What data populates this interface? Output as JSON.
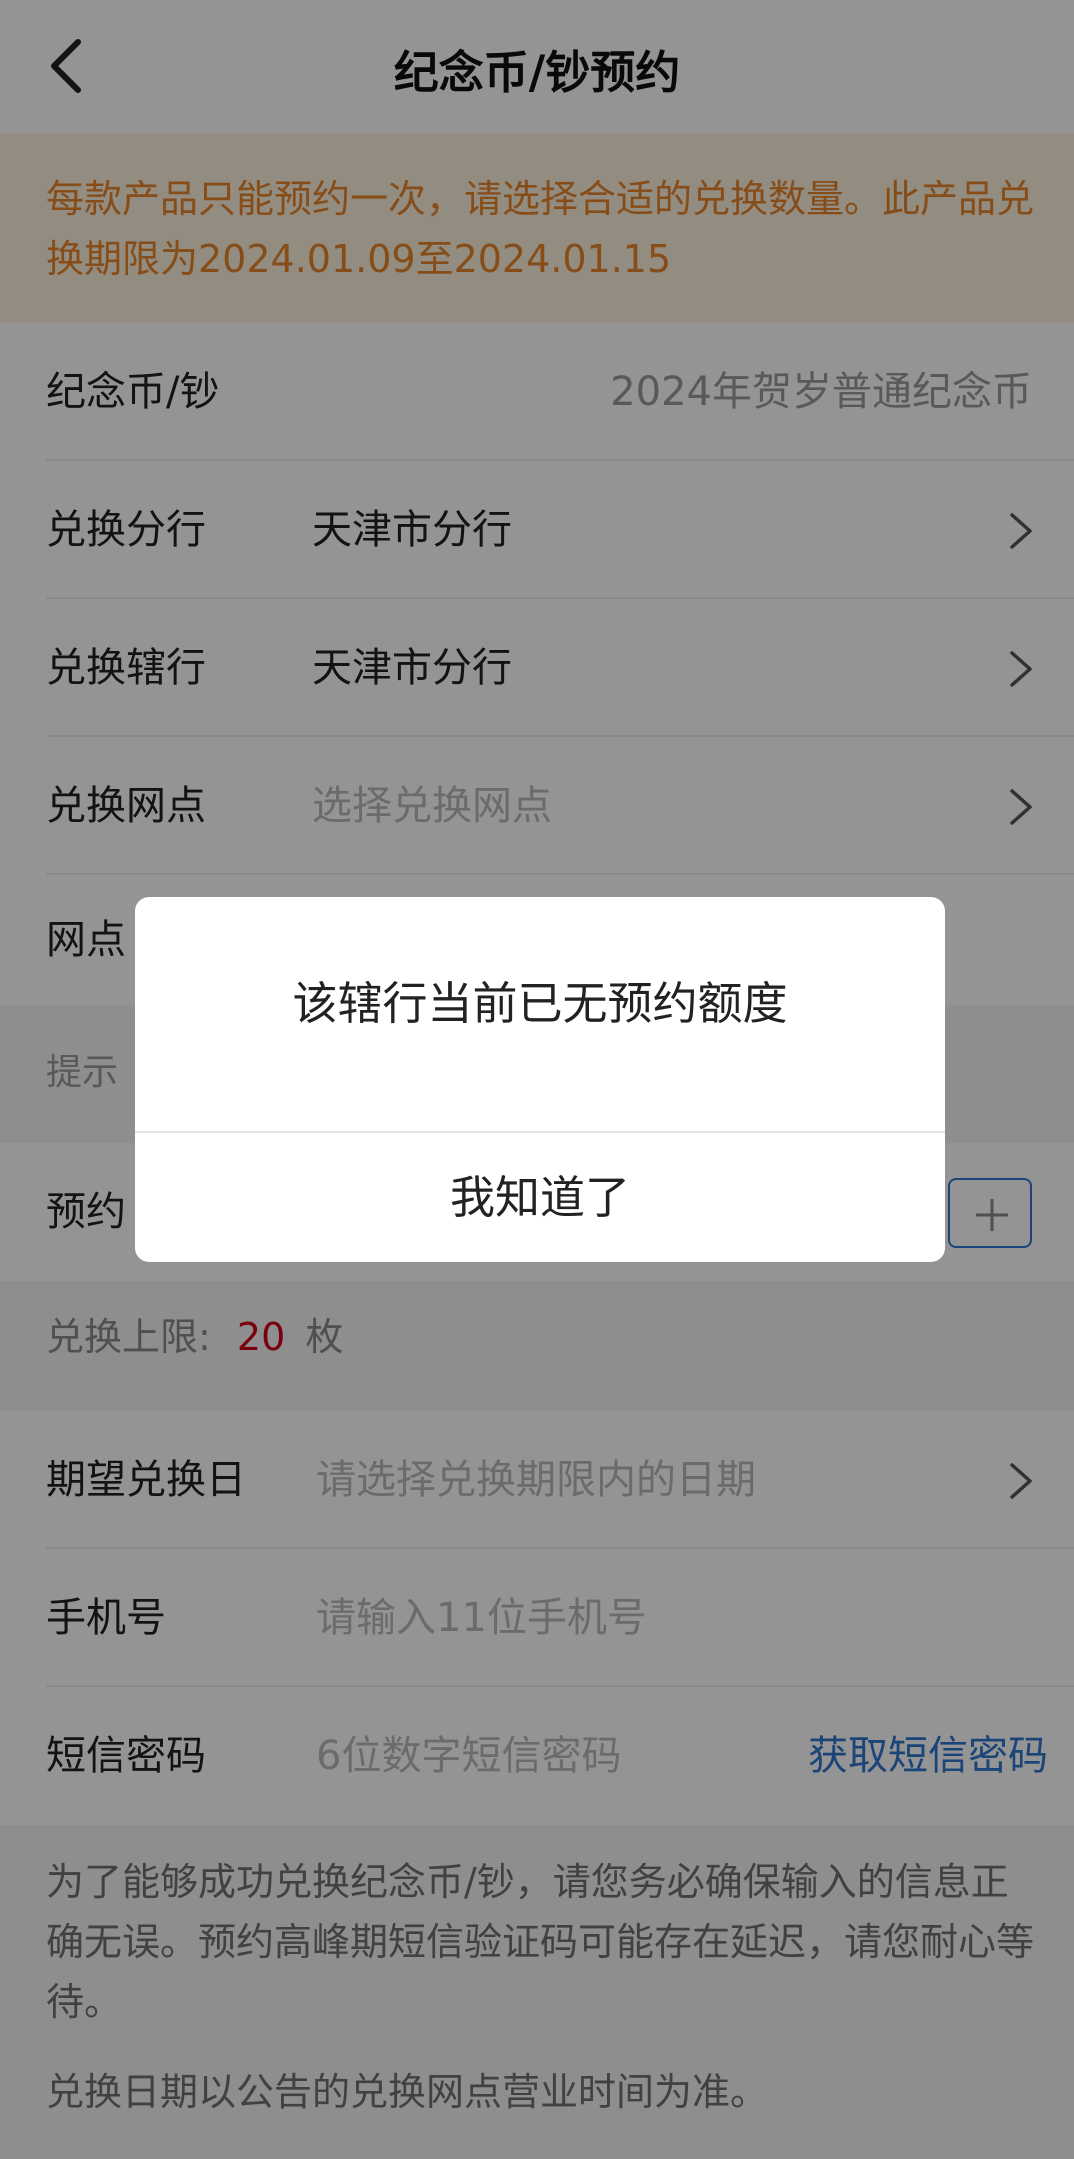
{
  "header": {
    "title": "纪念币/钞预约"
  },
  "notice": {
    "text": "每款产品只能预约一次，请选择合适的兑换数量。此产品兑换期限为2024.01.09至2024.01.15"
  },
  "form": {
    "coin": {
      "label": "纪念币/钞",
      "value": "2024年贺岁普通纪念币"
    },
    "branch": {
      "label": "兑换分行",
      "value": "天津市分行"
    },
    "sub_branch": {
      "label": "兑换辖行",
      "value": "天津市分行"
    },
    "outlet": {
      "label": "兑换网点",
      "placeholder": "选择兑换网点"
    },
    "outlet_addr": {
      "label": "网点"
    },
    "tip_label": "提示",
    "quantity": {
      "label": "预约"
    },
    "limit": {
      "label": "兑换上限:",
      "value": "20",
      "unit": "枚"
    },
    "date": {
      "label": "期望兑换日",
      "placeholder": "请选择兑换期限内的日期"
    },
    "phone": {
      "label": "手机号",
      "placeholder": "请输入11位手机号"
    },
    "sms": {
      "label": "短信密码",
      "placeholder": "6位数字短信密码",
      "button": "获取短信密码"
    }
  },
  "footer": {
    "para1": "为了能够成功兑换纪念币/钞，请您务必确保输入的信息正确无误。预约高峰期短信验证码可能存在延迟，请您耐心等待。",
    "para2": "兑换日期以公告的兑换网点营业时间为准。"
  },
  "dialog": {
    "message": "该辖行当前已无预约额度",
    "button": "我知道了"
  },
  "colors": {
    "accent": "#2f78d0",
    "warning": "#e8852c",
    "limit_value": "#d0021b"
  }
}
